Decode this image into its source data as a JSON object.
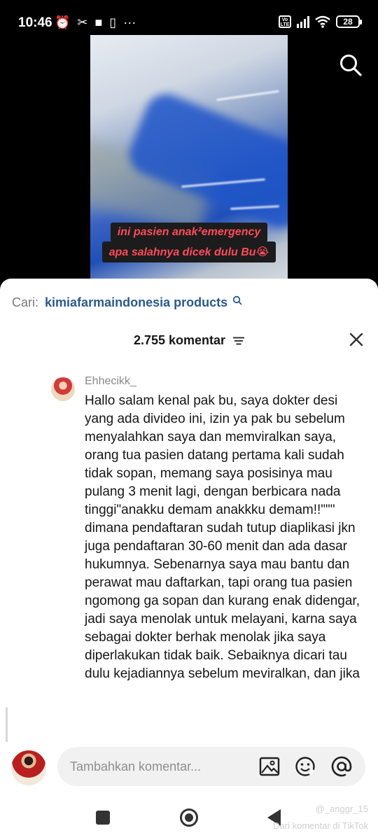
{
  "status_bar": {
    "time": "10:46",
    "left_icons": [
      "alarm-icon",
      "capcut-icon",
      "square-icon",
      "vibrate-icon",
      "more-dots-icon"
    ],
    "volte": "Vo LTE",
    "battery": "28"
  },
  "video": {
    "caption_line1": "ini pasien anak²emergency",
    "caption_line2": "apa salahnya dicek dulu Bu😭"
  },
  "comments_sheet": {
    "search_prefix": "Cari:",
    "search_term": "kimiafarmaindonesia products",
    "comment_count": "2.755 komentar",
    "comment": {
      "username": "Ehhecikk_",
      "text": "Hallo salam kenal pak bu, saya dokter desi yang ada divideo ini, izin ya pak bu sebelum menyalahkan saya dan memviralkan saya, orang tua pasien datang pertama kali sudah tidak sopan, memang saya posisinya mau pulang 3 menit lagi, dengan berbicara nada tinggi\"anakku demam anakkku demam!!\"\"\" dimana pendaftaran sudah tutup diaplikasi jkn juga pendaftaran 30-60 menit dan ada dasar hukumnya. Sebenarnya saya mau bantu dan perawat mau daftarkan, tapi orang tua pasien ngomong ga sopan dan kurang enak didengar, jadi saya menolak untuk melayani, karna saya sebagai dokter berhak menolak jika saya diperlakukan tidak baik. Sebaiknya dicari tau dulu kejadiannya sebelum meviralkan, dan jika"
    }
  },
  "input_bar": {
    "placeholder": "Tambahkan komentar..."
  },
  "watermark": {
    "line1": "@_anggr_15",
    "line2": "Dari komentar di TikTok"
  },
  "colors": {
    "link": "#2a5a8c",
    "caption_text": "#ff4b5c",
    "caption_bg": "#1c1c1c",
    "video_blue": "#1f4fb8"
  }
}
